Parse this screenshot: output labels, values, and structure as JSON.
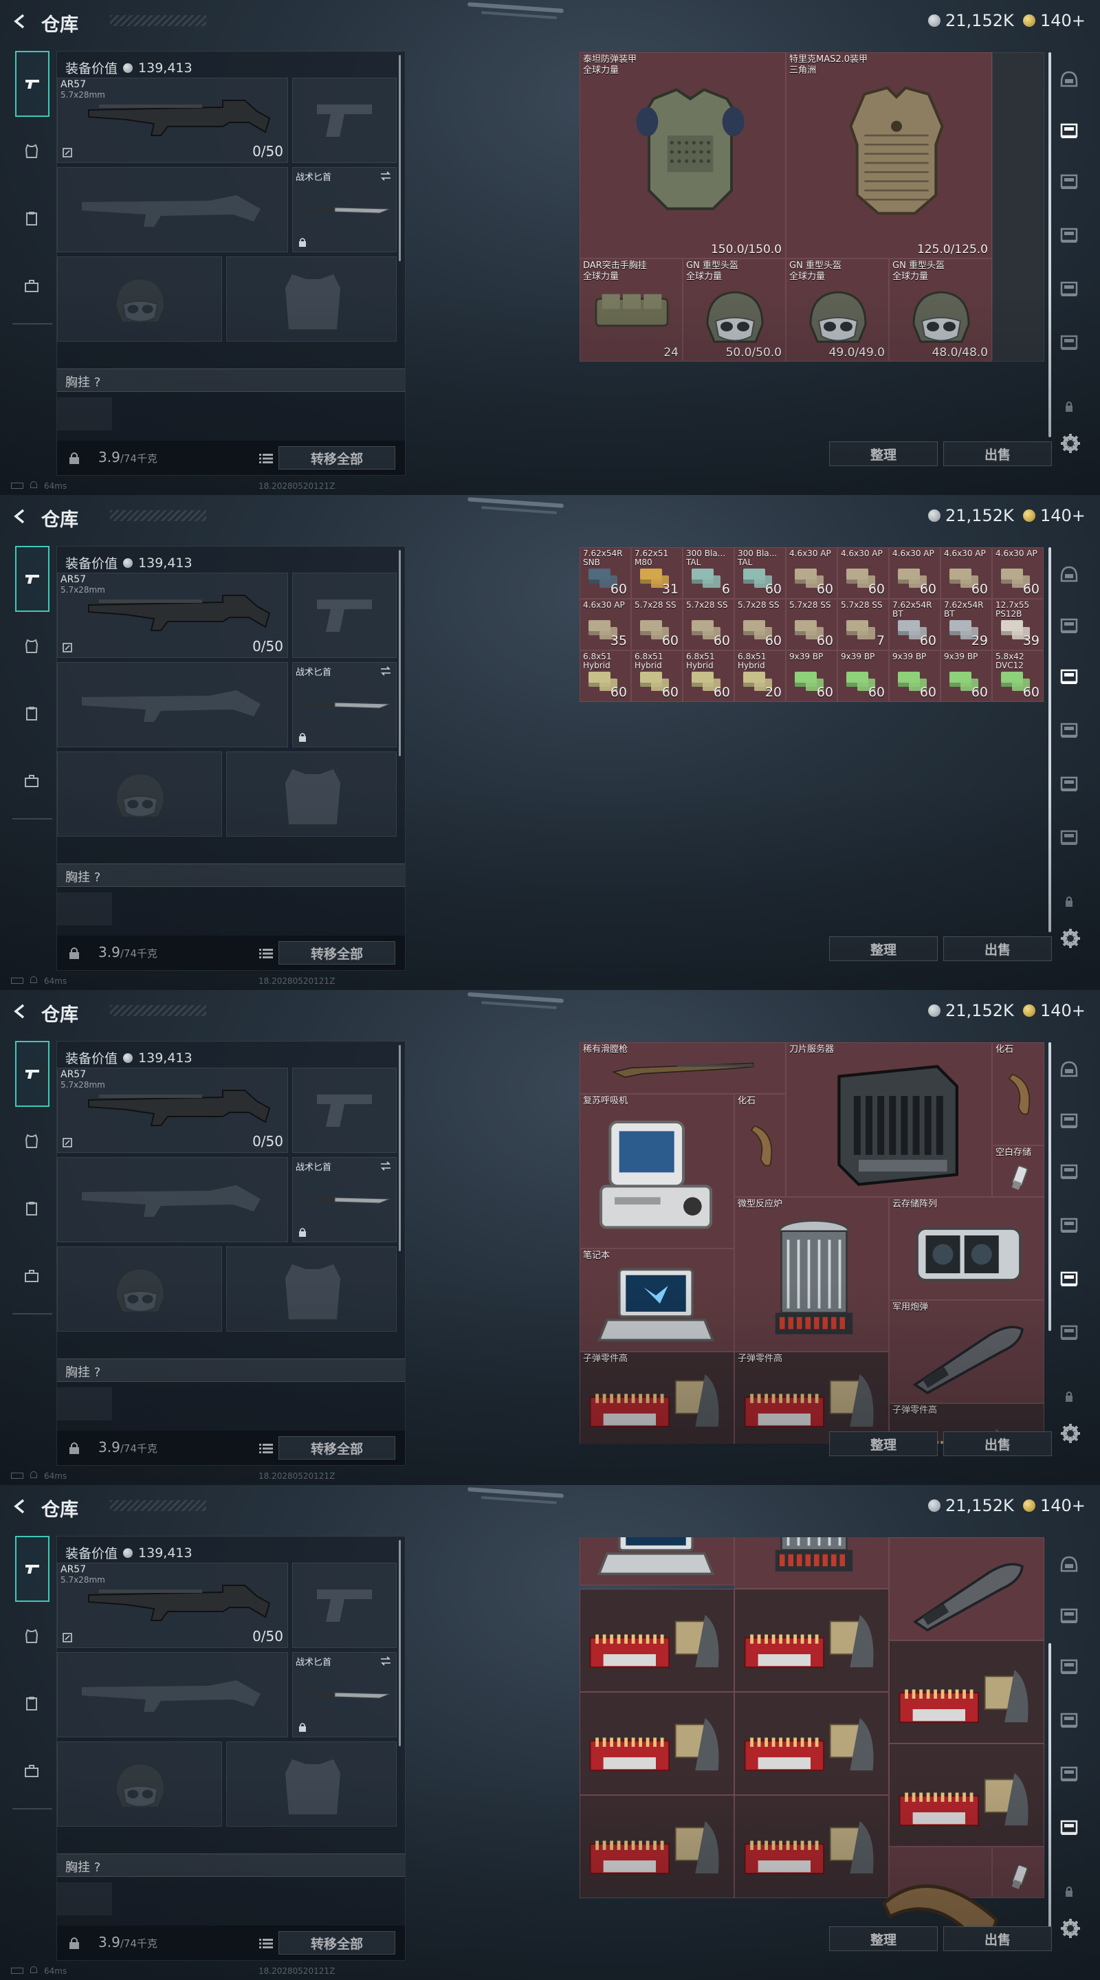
{
  "header": {
    "title": "仓库",
    "silver": "21,152K",
    "gold": "140+"
  },
  "loadout": {
    "value_label": "装备价值",
    "value": "139,413",
    "primary": {
      "name": "AR57",
      "caliber": "5.7x28mm",
      "ammo": "0/50"
    },
    "knife_label": "战术匕首",
    "chest_label": "胸挂 ?",
    "weight": "3.9",
    "weight_unit": "/74千克",
    "transfer_all": "转移全部"
  },
  "actions": {
    "sort": "整理",
    "sell": "出售"
  },
  "status": {
    "ping": "64ms",
    "build": "18.20280520121Z"
  },
  "screens": [
    {
      "cells": [
        {
          "name": "泰坦防弹装甲",
          "sub": "全球力量",
          "val": "150.0/150.0",
          "type": "armor"
        },
        {
          "name": "特里克MAS2.0装甲",
          "sub": "三角洲",
          "val": "125.0/125.0",
          "type": "armor2"
        },
        {
          "name": "DAR突击手胸挂",
          "sub": "全球力量",
          "val": "24",
          "type": "rig"
        },
        {
          "name": "GN 重型头盔",
          "sub": "全球力量",
          "val": "50.0/50.0",
          "type": "helmet"
        },
        {
          "name": "GN 重型头盔",
          "sub": "全球力量",
          "val": "49.0/49.0",
          "type": "helmet"
        },
        {
          "name": "GN 重型头盔",
          "sub": "全球力量",
          "val": "48.0/48.0",
          "type": "helmet"
        }
      ]
    },
    {
      "ammo": [
        {
          "n": "7.62x54R SNB",
          "v": "60"
        },
        {
          "n": "7.62x51 M80",
          "v": "31"
        },
        {
          "n": "300 Bla... TAL",
          "v": "6"
        },
        {
          "n": "300 Bla... TAL",
          "v": "60"
        },
        {
          "n": "4.6x30 AP",
          "v": "60"
        },
        {
          "n": "4.6x30 AP",
          "v": "60"
        },
        {
          "n": "4.6x30 AP",
          "v": "60"
        },
        {
          "n": "4.6x30 AP",
          "v": "60"
        },
        {
          "n": "4.6x30 AP",
          "v": "60"
        },
        {
          "n": "4.6x30 AP",
          "v": "35"
        },
        {
          "n": "5.7x28 SS",
          "v": "60"
        },
        {
          "n": "5.7x28 SS",
          "v": "60"
        },
        {
          "n": "5.7x28 SS",
          "v": "60"
        },
        {
          "n": "5.7x28 SS",
          "v": "60"
        },
        {
          "n": "5.7x28 SS",
          "v": "7"
        },
        {
          "n": "7.62x54R BT",
          "v": "60"
        },
        {
          "n": "7.62x54R BT",
          "v": "29"
        },
        {
          "n": "12.7x55 PS12B",
          "v": "39"
        },
        {
          "n": "6.8x51 Hybrid",
          "v": "60"
        },
        {
          "n": "6.8x51 Hybrid",
          "v": "60"
        },
        {
          "n": "6.8x51 Hybrid",
          "v": "60"
        },
        {
          "n": "6.8x51 Hybrid",
          "v": "20"
        },
        {
          "n": "9x39 BP",
          "v": "60"
        },
        {
          "n": "9x39 BP",
          "v": "60"
        },
        {
          "n": "9x39 BP",
          "v": "60"
        },
        {
          "n": "9x39 BP",
          "v": "60"
        },
        {
          "n": "5.8x42 DVC12",
          "v": "60"
        }
      ]
    },
    {
      "items": {
        "rifle": "稀有滑膛枪",
        "server": "刀片服务器",
        "fossil": "化石",
        "respirator": "复苏呼吸机",
        "fossil2": "化石",
        "usb": "空白存储",
        "reactor": "微型反应炉",
        "cloud": "云存储阵列",
        "laptop": "笔记本",
        "shell": "军用炮弹",
        "parts": "子弹零件高"
      }
    },
    {
      "items": {
        "shell": "军用炮弹",
        "parts": "子弹零件高",
        "fossil": "化石",
        "usb": "空白存储"
      }
    }
  ]
}
